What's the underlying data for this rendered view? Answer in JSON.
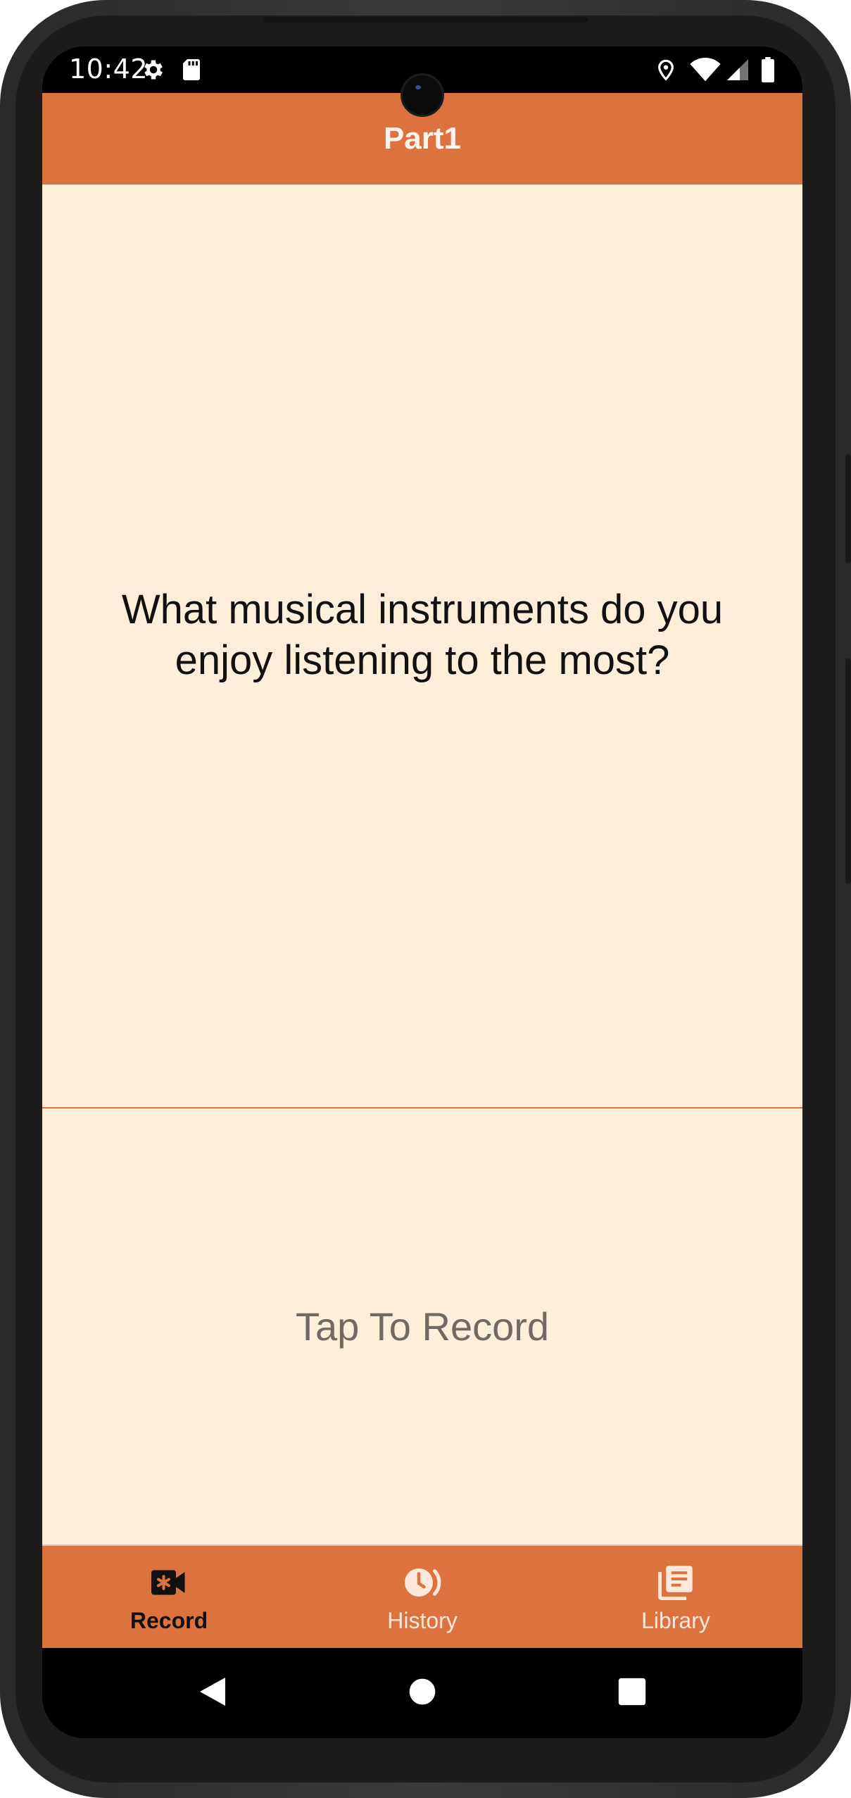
{
  "status_bar": {
    "time": "10:42",
    "icons": [
      "settings-icon",
      "sd-card-icon",
      "location-icon",
      "wifi-icon",
      "cell-signal-icon",
      "battery-icon"
    ]
  },
  "app_bar": {
    "title": "Part1"
  },
  "question": {
    "text": "What musical instruments do you enjoy listening to the most?"
  },
  "record": {
    "label": "Tap To Record"
  },
  "bottom_nav": {
    "items": [
      {
        "label": "Record",
        "icon": "video-record-icon",
        "active": true
      },
      {
        "label": "History",
        "icon": "history-icon",
        "active": false
      },
      {
        "label": "Library",
        "icon": "library-icon",
        "active": false
      }
    ]
  },
  "system_nav": {
    "buttons": [
      "back-icon",
      "home-icon",
      "recents-icon"
    ]
  },
  "colors": {
    "accent": "#dc733f",
    "background": "#fdeed9",
    "active_nav_text": "#111111",
    "inactive_nav_text": "#fde9dc",
    "record_text": "#6f6a64"
  }
}
